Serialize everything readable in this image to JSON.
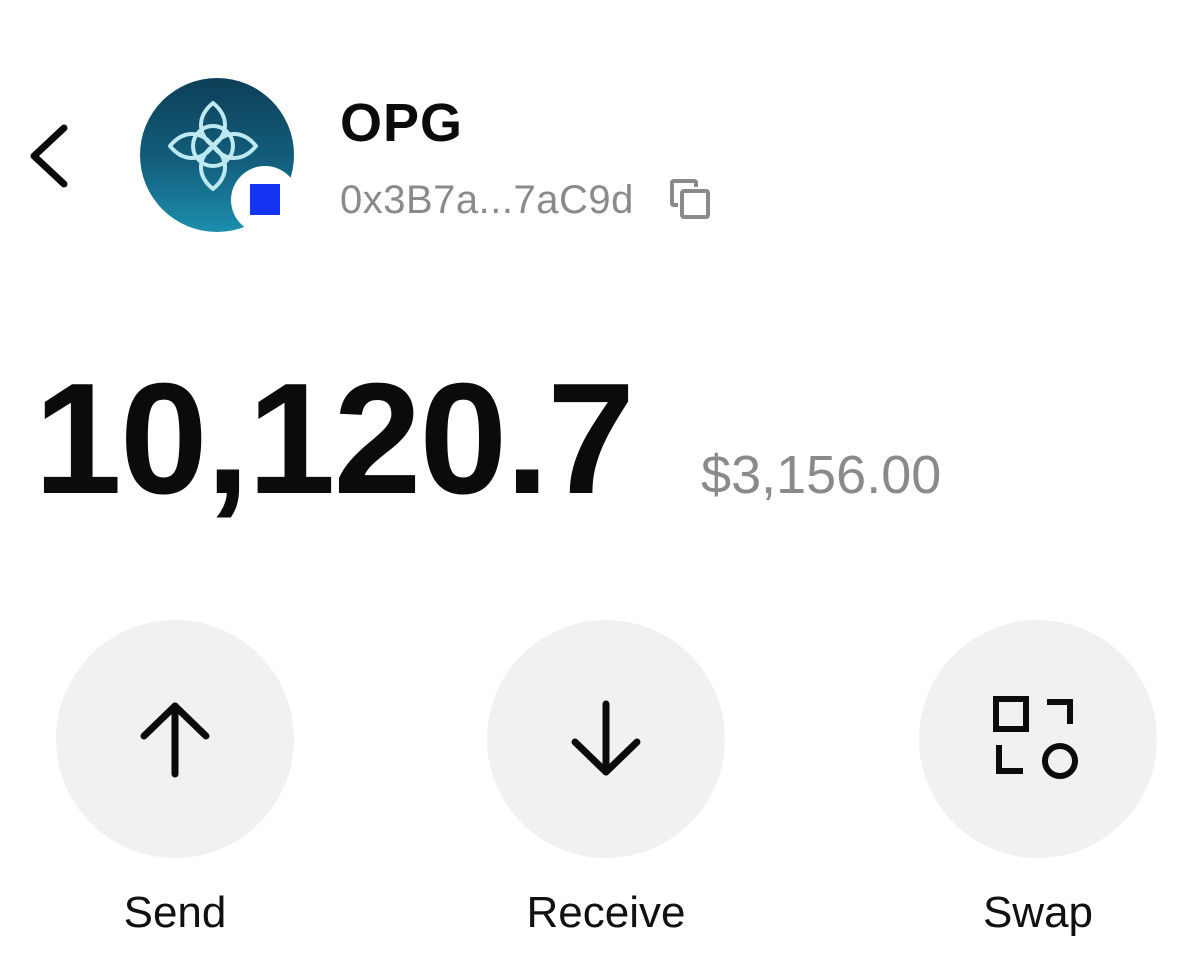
{
  "header": {
    "back_icon": "chevron-left-icon",
    "token_symbol": "OPG",
    "address": "0x3B7a...7aC9d",
    "copy_icon": "copy-icon",
    "token_logo_icon": "quatrefoil-knot-icon",
    "network_badge_icon": "blue-square-icon"
  },
  "balance": {
    "amount": "10,120.7",
    "fiat_value": "$3,156.00"
  },
  "actions": [
    {
      "label": "Send",
      "icon": "arrow-up-icon"
    },
    {
      "label": "Receive",
      "icon": "arrow-down-icon"
    },
    {
      "label": "Swap",
      "icon": "swap-icon"
    }
  ],
  "colors": {
    "text_primary": "#0b0b0b",
    "text_secondary": "#8a8a8a",
    "action_background": "#f1f1f1",
    "avatar_gradient_top": "#0d3f57",
    "avatar_gradient_bottom": "#1c8fad",
    "network_badge": "#1334f2"
  }
}
